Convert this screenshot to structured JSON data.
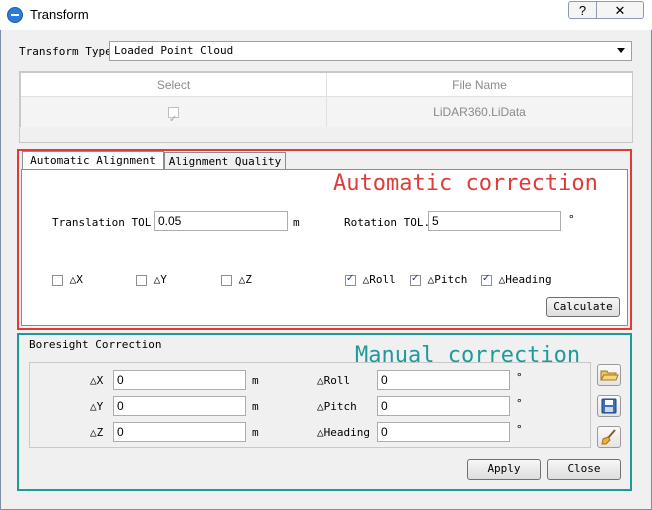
{
  "window": {
    "title": "Transform",
    "help_label": "?",
    "close_label": "✕"
  },
  "transform_type": {
    "label": "Transform Type",
    "selected": "Loaded Point Cloud"
  },
  "file_table": {
    "headers": [
      "Select",
      "File Name"
    ],
    "rows": [
      {
        "selected": true,
        "file_name": "LiDAR360.LiData"
      }
    ]
  },
  "annotations": {
    "automatic": "Automatic correction",
    "manual": "Manual correction",
    "automatic_color": "#e03b3b",
    "manual_color": "#1e9a9a"
  },
  "tabs": {
    "automatic_alignment": "Automatic Alignment",
    "alignment_quality": "Alignment Quality"
  },
  "automatic": {
    "translation_label": "Translation TOL.",
    "translation_value": "0.05",
    "translation_unit": "m",
    "rotation_label": "Rotation TOL.",
    "rotation_value": "5",
    "rotation_unit": "°",
    "checks": [
      {
        "label": "△X",
        "checked": false
      },
      {
        "label": "△Y",
        "checked": false
      },
      {
        "label": "△Z",
        "checked": false
      },
      {
        "label": "△Roll",
        "checked": true
      },
      {
        "label": "△Pitch",
        "checked": true
      },
      {
        "label": "△Heading",
        "checked": true
      }
    ],
    "calculate_label": "Calculate"
  },
  "boresight": {
    "title": "Boresight Correction",
    "fields": {
      "dx": {
        "label": "△X",
        "value": "0",
        "unit": "m"
      },
      "dy": {
        "label": "△Y",
        "value": "0",
        "unit": "m"
      },
      "dz": {
        "label": "△Z",
        "value": "0",
        "unit": "m"
      },
      "droll": {
        "label": "△Roll",
        "value": "0",
        "unit": "°"
      },
      "dpitch": {
        "label": "△Pitch",
        "value": "0",
        "unit": "°"
      },
      "dheading": {
        "label": "△Heading",
        "value": "0",
        "unit": "°"
      }
    },
    "icons": [
      "open-folder-icon",
      "save-icon",
      "clear-brush-icon"
    ]
  },
  "footer": {
    "apply_label": "Apply",
    "close_label": "Close"
  }
}
